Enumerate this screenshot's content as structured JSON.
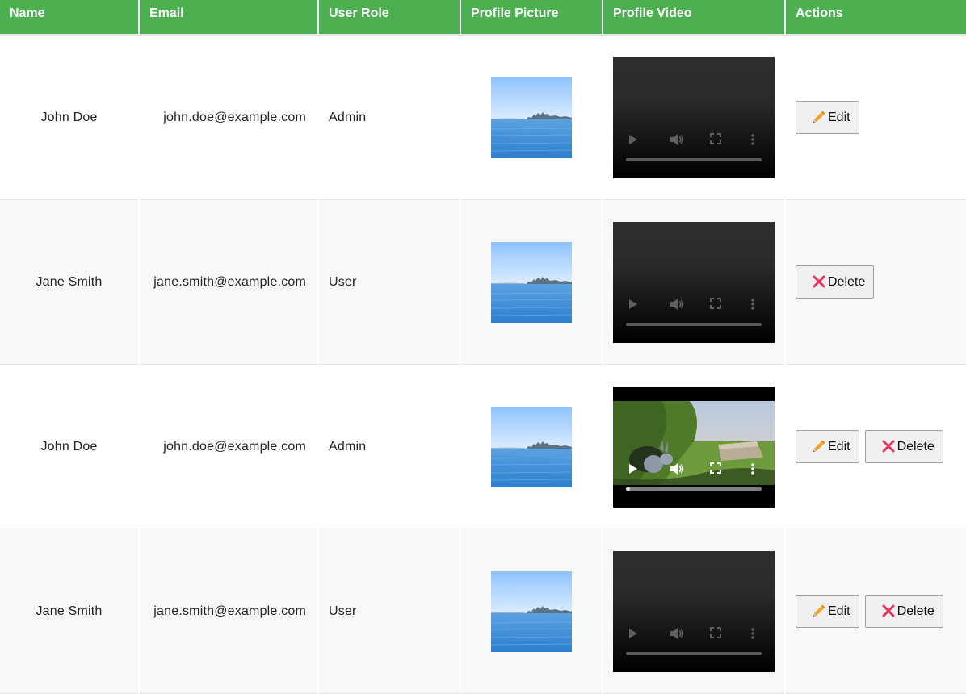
{
  "table": {
    "headers": [
      "Name",
      "Email",
      "User Role",
      "Profile Picture",
      "Profile Video",
      "Actions"
    ],
    "rows": [
      {
        "name": "John Doe",
        "email": "john.doe@example.com",
        "role": "Admin"
      },
      {
        "name": "Jane Smith",
        "email": "jane.smith@example.com",
        "role": "User"
      },
      {
        "name": "John Doe",
        "email": "john.doe@example.com",
        "role": "Admin"
      },
      {
        "name": "Jane Smith",
        "email": "jane.smith@example.com",
        "role": "User"
      }
    ]
  },
  "actions": {
    "edit_label": "Edit",
    "delete_label": "Delete",
    "edit_icon": "pencil-icon",
    "delete_icon": "cross-icon"
  },
  "video": {
    "active_row_progress": 0.03
  },
  "colors": {
    "header_bg": "#4caf50",
    "header_text": "#ffffff",
    "edit_icon": "#f4a428",
    "delete_icon": "#e8345d",
    "row_alt_bg": "#f8f8f8"
  }
}
